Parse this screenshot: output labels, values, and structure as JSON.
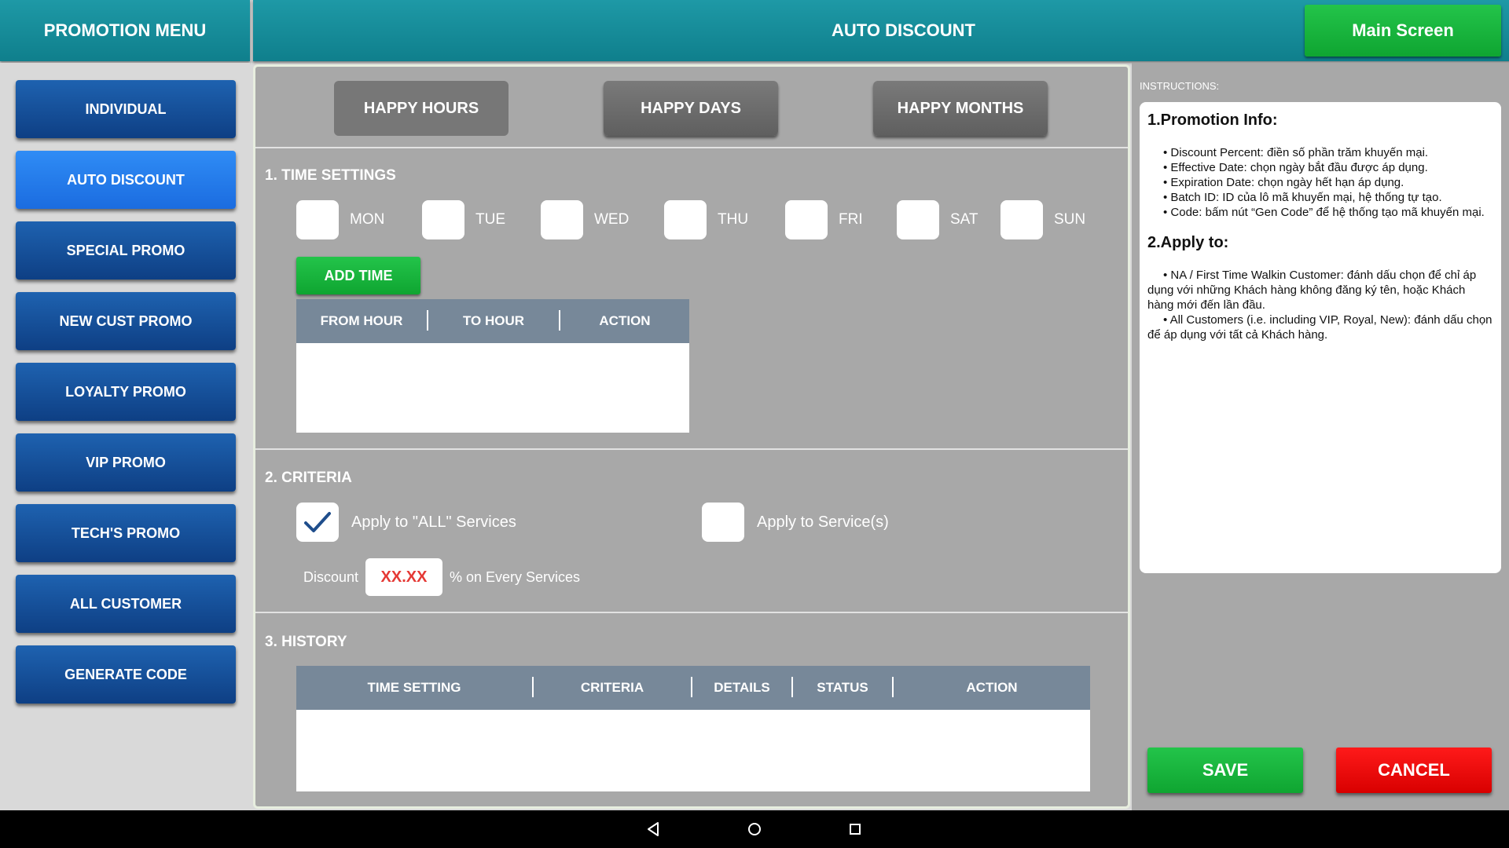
{
  "header": {
    "menu_title": "PROMOTION MENU",
    "page_title": "AUTO DISCOUNT",
    "main_screen_label": "Main Screen"
  },
  "sidebar": {
    "items": [
      {
        "label": "INDIVIDUAL"
      },
      {
        "label": "AUTO DISCOUNT",
        "active": true
      },
      {
        "label": "SPECIAL PROMO"
      },
      {
        "label": "NEW CUST PROMO"
      },
      {
        "label": "LOYALTY PROMO"
      },
      {
        "label": "VIP PROMO"
      },
      {
        "label": "TECH'S PROMO"
      },
      {
        "label": "ALL CUSTOMER"
      },
      {
        "label": "GENERATE CODE"
      }
    ]
  },
  "tabs": [
    {
      "label": "HAPPY HOURS",
      "selected": true
    },
    {
      "label": "HAPPY DAYS"
    },
    {
      "label": "HAPPY MONTHS"
    }
  ],
  "time_settings": {
    "title": "1. TIME SETTINGS",
    "days": [
      "MON",
      "TUE",
      "WED",
      "THU",
      "FRI",
      "SAT",
      "SUN"
    ],
    "add_time_label": "ADD TIME",
    "columns": [
      "FROM HOUR",
      "TO HOUR",
      "ACTION"
    ]
  },
  "criteria": {
    "title": "2. CRITERIA",
    "all_services_label": "Apply to \"ALL\" Services",
    "all_services_checked": true,
    "services_label": "Apply to Service(s)",
    "services_checked": false,
    "discount_label": "Discount",
    "discount_value": "XX.XX",
    "discount_suffix": "% on Every Services"
  },
  "history": {
    "title": "3. HISTORY",
    "columns": [
      "TIME SETTING",
      "CRITERIA",
      "DETAILS",
      "STATUS",
      "ACTION"
    ]
  },
  "instructions": {
    "label": "INSTRUCTIONS:",
    "section1_title": "1.Promotion Info:",
    "section1_items": [
      "• Discount Percent: điền số phần trăm khuyến mại.",
      "• Effective Date: chọn ngày bắt đầu được áp dụng.",
      "• Expiration Date: chọn ngày hết hạn áp dụng.",
      "• Batch ID: ID của lô mã khuyến mại, hệ thống tự tạo.",
      "• Code: bấm nút “Gen Code” để hệ thống tạo mã khuyến mại."
    ],
    "section2_title": "2.Apply to:",
    "section2_items": [
      "• NA / First Time Walkin Customer: đánh dấu chọn để chỉ áp dụng với những Khách hàng không đăng ký tên, hoặc Khách hàng mới đến lần đầu.",
      "• All Customers (i.e. including VIP, Royal, New): đánh dấu chọn để áp dụng với tất cả Khách hàng."
    ]
  },
  "actions": {
    "save_label": "SAVE",
    "cancel_label": "CANCEL"
  },
  "colors": {
    "header_teal": "#138a97",
    "sidebar_blue": "#0e3f84",
    "active_blue": "#1b6ce0",
    "green": "#0fa531",
    "red": "#d80000",
    "table_header": "#778899",
    "discount_red": "#e53935"
  },
  "navbar": {
    "icons": [
      "back-icon",
      "home-icon",
      "recents-icon"
    ]
  }
}
